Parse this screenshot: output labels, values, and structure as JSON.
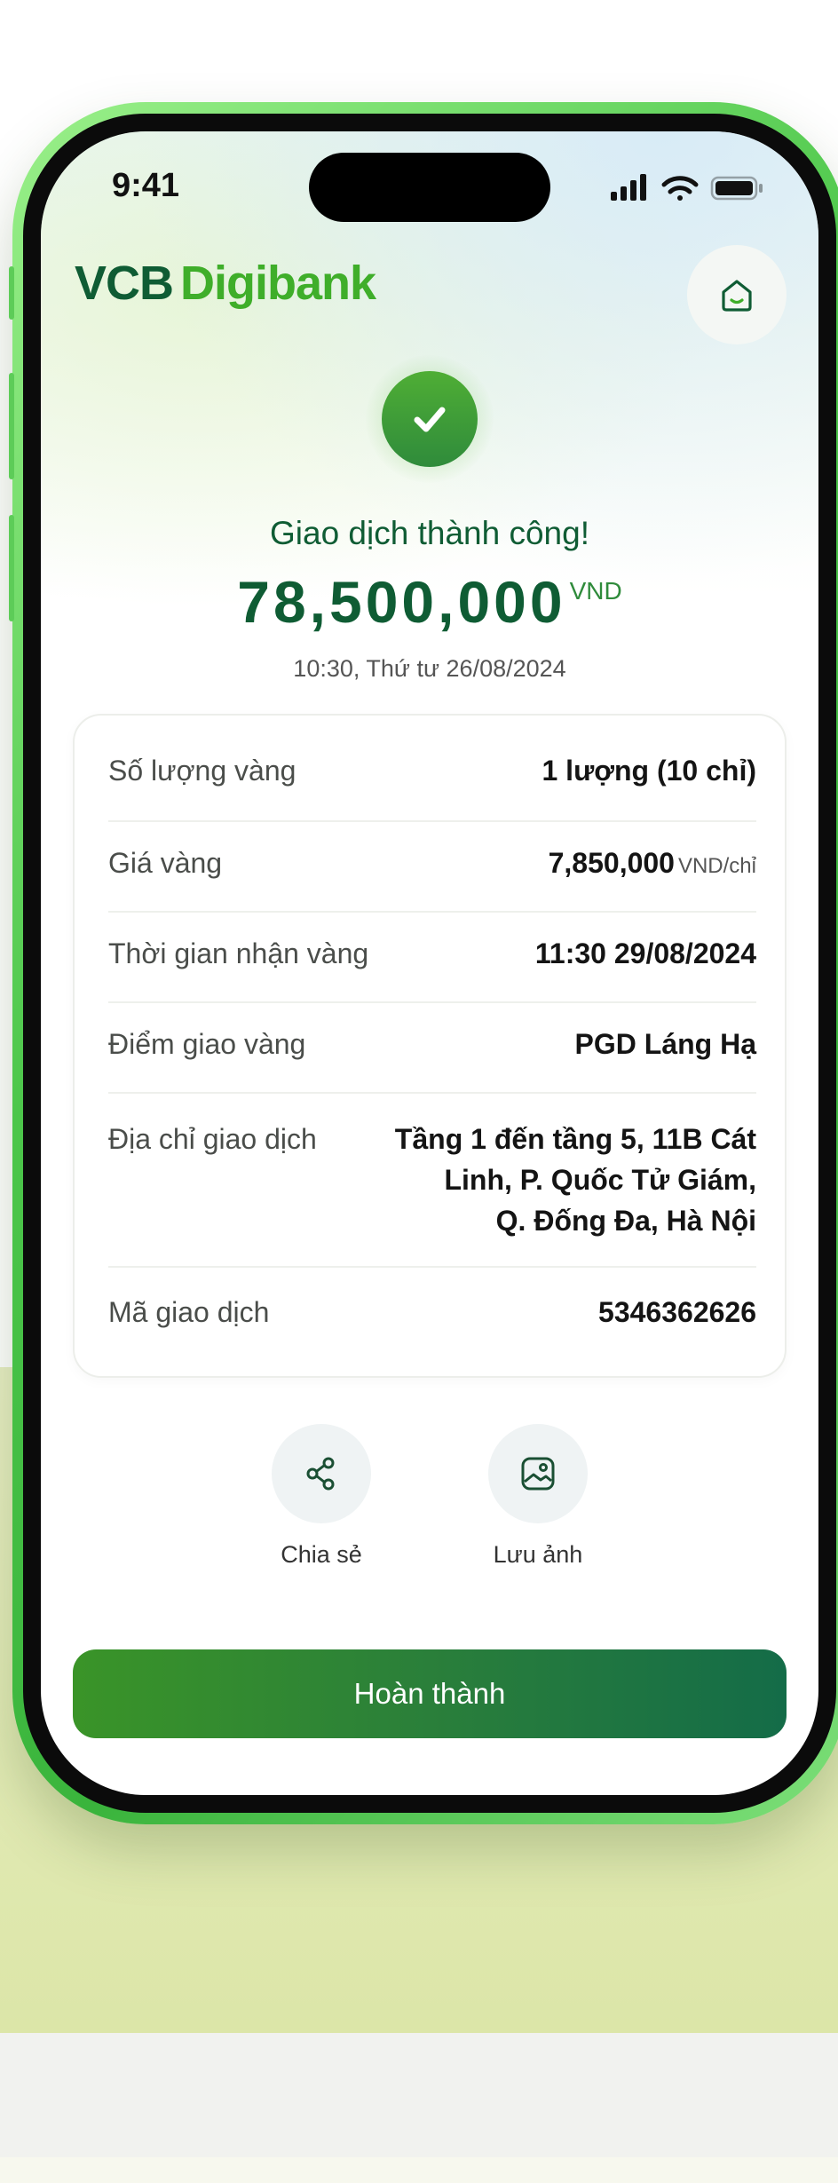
{
  "status_bar": {
    "time": "9:41"
  },
  "brand": {
    "part1": "VCB",
    "part2": "Digibank"
  },
  "result": {
    "title": "Giao dịch thành công!",
    "amount": "78,500,000",
    "currency": "VND",
    "datetime": "10:30, Thứ tư 26/08/2024"
  },
  "details": [
    {
      "label": "Số lượng vàng",
      "value": "1 lượng (10 chỉ)"
    },
    {
      "label": "Giá vàng",
      "value": "7,850,000",
      "unit": "VND/chỉ"
    },
    {
      "label": "Thời gian nhận vàng",
      "value": "11:30 29/08/2024"
    },
    {
      "label": "Điểm giao vàng",
      "value": "PGD Láng Hạ"
    },
    {
      "label": "Địa chỉ giao dịch",
      "value_lines": [
        "Tầng 1 đến tầng 5, 11B Cát",
        "Linh, P. Quốc Tử Giám,",
        "Q. Đống Đa, Hà Nội"
      ]
    },
    {
      "label": "Mã giao dịch",
      "value": "5346362626"
    }
  ],
  "actions": {
    "share": {
      "label": "Chia sẻ",
      "icon": "share-icon"
    },
    "save_image": {
      "label": "Lưu ảnh",
      "icon": "image-icon"
    }
  },
  "primary_button": {
    "label": "Hoàn thành"
  },
  "colors": {
    "brand_dark": "#0f5c34",
    "brand_green": "#3fae2a",
    "button_start": "#3a9428",
    "button_end": "#146c48",
    "frame_green": "#4cc64a"
  }
}
